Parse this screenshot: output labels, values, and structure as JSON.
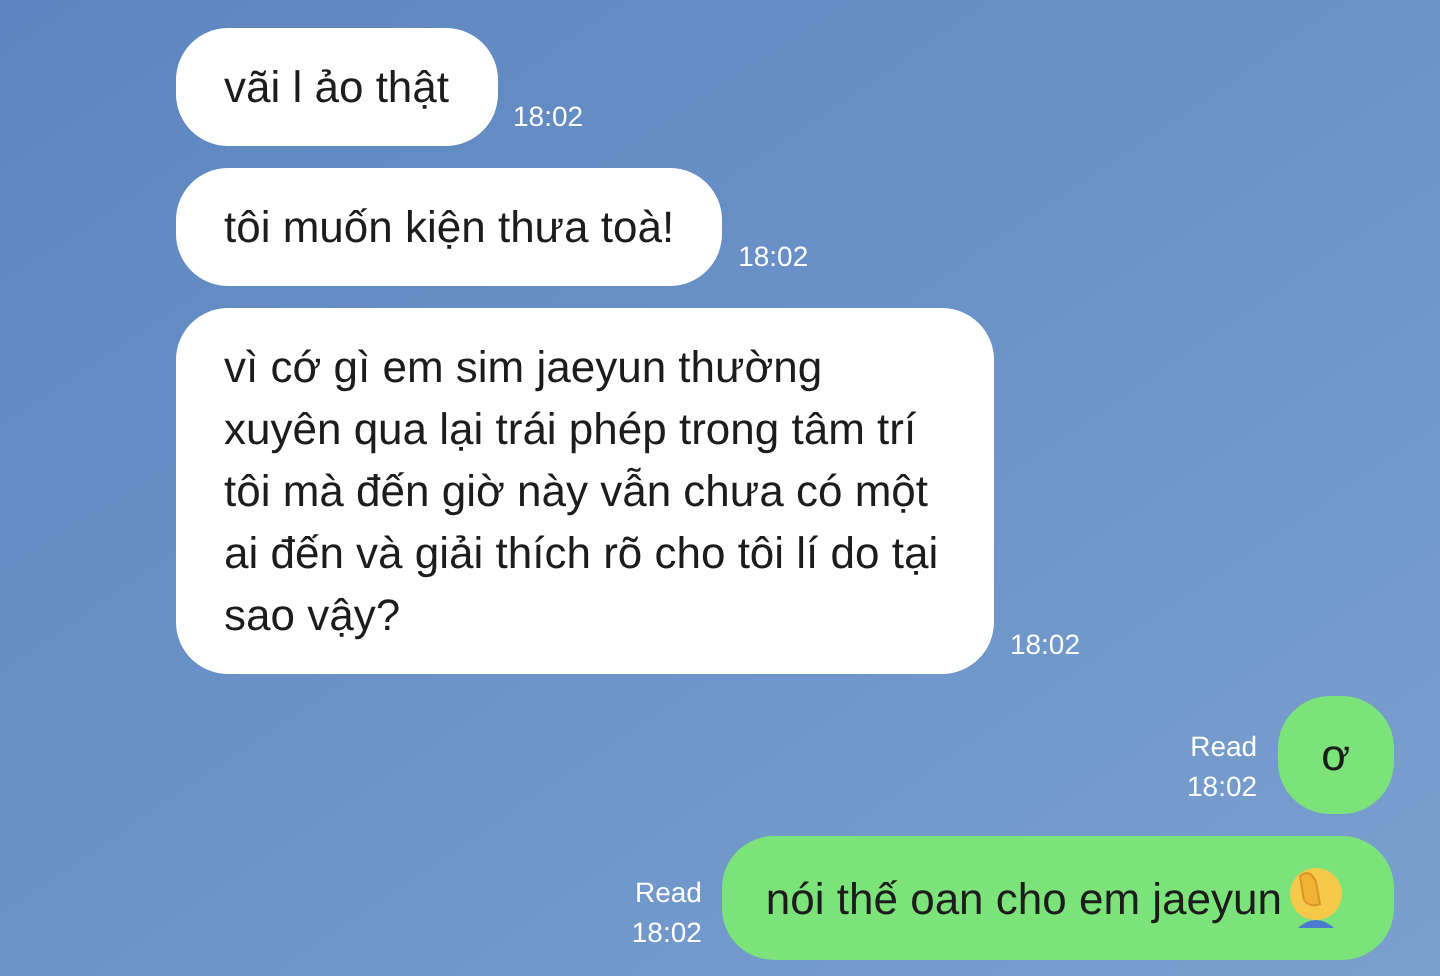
{
  "messages": [
    {
      "kind": "incoming",
      "text": "vãi l ảo thật",
      "time": "18:02"
    },
    {
      "kind": "incoming",
      "text": "tôi muốn kiện thưa toà!",
      "time": "18:02"
    },
    {
      "kind": "incoming",
      "text": "vì cớ gì em sim jaeyun thường xuyên qua lại trái phép trong tâm trí tôi mà đến giờ này vẫn chưa có một ai đến và giải thích rõ cho tôi lí do tại sao vậy?",
      "time": "18:02"
    },
    {
      "kind": "outgoing",
      "text": "ơ",
      "time": "18:02",
      "status": "Read",
      "facepalm": false
    },
    {
      "kind": "outgoing",
      "text": "nói thế oan cho em jaeyun",
      "time": "18:02",
      "status": "Read",
      "facepalm": true
    }
  ]
}
